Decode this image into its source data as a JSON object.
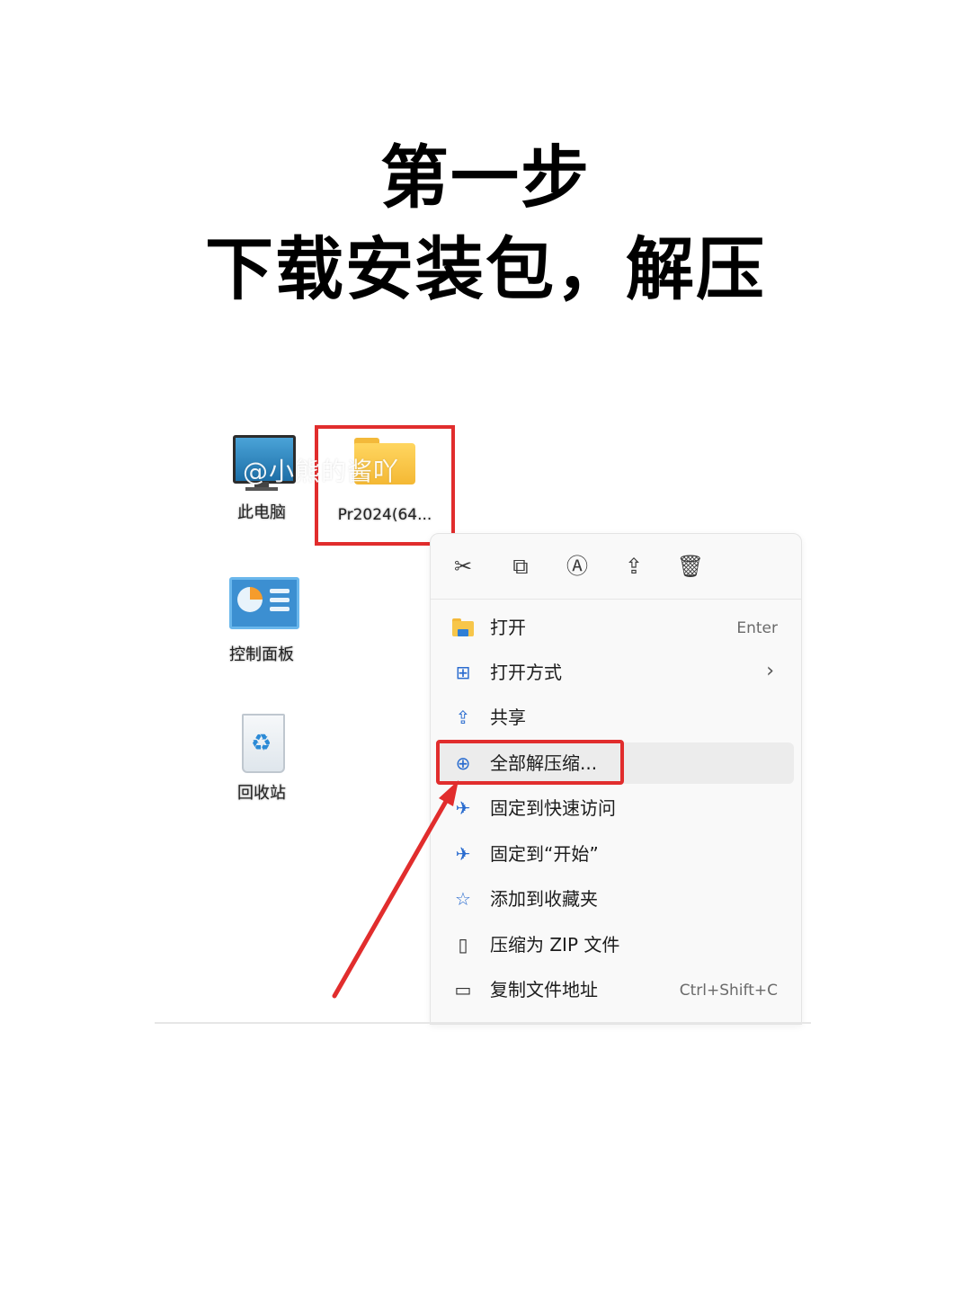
{
  "title": {
    "line1": "第一步",
    "line2": "下载安装包，解压"
  },
  "watermark": "@小熊的酱吖",
  "desktop": {
    "icons": [
      {
        "label": "此电脑",
        "icon": "computer-icon"
      },
      {
        "label": "控制面板",
        "icon": "control-panel-icon"
      },
      {
        "label": "回收站",
        "icon": "recycle-bin-icon"
      }
    ],
    "selected_file": {
      "label": "Pr2024(64...",
      "icon": "folder-icon"
    }
  },
  "toolbar": [
    {
      "icon": "cut-icon",
      "glyph": "✂"
    },
    {
      "icon": "copy-icon",
      "glyph": "⧉"
    },
    {
      "icon": "rename-icon",
      "glyph": "Ⓐ"
    },
    {
      "icon": "share-icon",
      "glyph": "⇪"
    },
    {
      "icon": "delete-icon",
      "glyph": "🗑"
    }
  ],
  "menu": {
    "items": [
      {
        "label": "打开",
        "shortcut": "Enter",
        "icon": "folder-open-icon"
      },
      {
        "label": "打开方式",
        "chevron": "›",
        "icon": "open-with-icon",
        "glyph": "⊞"
      },
      {
        "label": "共享",
        "icon": "share-icon",
        "glyph": "⇪"
      },
      {
        "label": "全部解压缩...",
        "icon": "extract-icon",
        "glyph": "⊕"
      },
      {
        "label": "固定到快速访问",
        "icon": "pin-icon",
        "glyph": "✈"
      },
      {
        "label": "固定到“开始”",
        "icon": "pin-start-icon",
        "glyph": "✈"
      },
      {
        "label": "添加到收藏夹",
        "icon": "star-icon",
        "glyph": "☆"
      },
      {
        "label": "压缩为 ZIP 文件",
        "icon": "zip-icon",
        "glyph": "▯"
      },
      {
        "label": "复制文件地址",
        "shortcut": "Ctrl+Shift+C",
        "icon": "copy-path-icon",
        "glyph": "▭"
      }
    ]
  },
  "colors": {
    "highlight_red": "#e12d2d",
    "menu_bg": "#f9f9f9",
    "accent_blue": "#2a6ccf"
  }
}
